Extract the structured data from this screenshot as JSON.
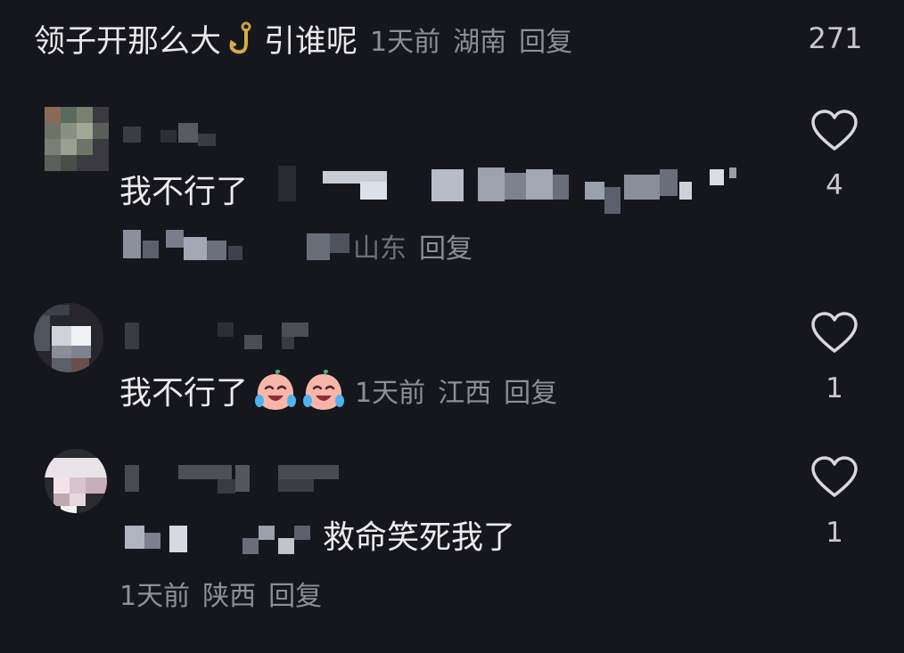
{
  "top_comment": {
    "text_before": "领子开那么大",
    "text_after": "引谁呢",
    "emoji": "hook-emoji",
    "time": "1天前",
    "location": "湖南",
    "reply": "回复",
    "likes": "271"
  },
  "comments": [
    {
      "text": "我不行了",
      "location_partial": "山东",
      "reply": "回复",
      "likes": "4",
      "icon": "heart-outline-icon"
    },
    {
      "text": "我不行了",
      "emoji": "crying-laughing-peach-emoji",
      "time": "1天前",
      "location": "江西",
      "reply": "回复",
      "likes": "1",
      "icon": "heart-outline-icon"
    },
    {
      "text": "救命笑死我了",
      "time": "1天前",
      "location": "陕西",
      "reply": "回复",
      "likes": "1",
      "icon": "heart-outline-icon"
    }
  ],
  "colors": {
    "background": "#16161d",
    "text_primary": "#ececef",
    "text_meta": "#8e8e96"
  }
}
